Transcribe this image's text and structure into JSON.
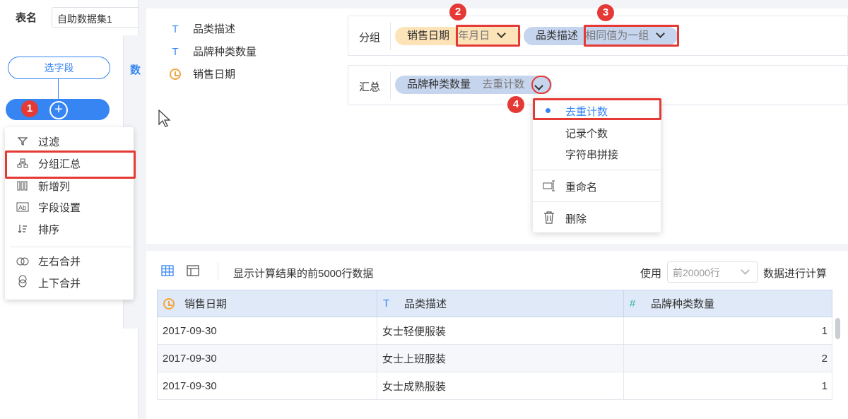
{
  "left_panel": {
    "table_label": "表名",
    "table_name": "自助数据集1",
    "select_fields_label": "选字段",
    "add_label": "+",
    "cut_label": "数"
  },
  "step_menu": {
    "items": [
      {
        "label": "过滤",
        "icon": "filter-icon"
      },
      {
        "label": "分组汇总",
        "icon": "group-icon"
      },
      {
        "label": "新增列",
        "icon": "add-column-icon"
      },
      {
        "label": "字段设置",
        "icon": "field-settings-icon"
      },
      {
        "label": "排序",
        "icon": "sort-icon"
      },
      {
        "label": "左右合并",
        "icon": "merge-horizontal-icon"
      },
      {
        "label": "上下合并",
        "icon": "merge-vertical-icon"
      }
    ]
  },
  "badges": [
    "1",
    "2",
    "3",
    "4"
  ],
  "fields": [
    {
      "label": "品类描述",
      "type": "text",
      "icon": "T"
    },
    {
      "label": "品牌种类数量",
      "type": "text",
      "icon": "T"
    },
    {
      "label": "销售日期",
      "type": "date",
      "icon": "clock-icon"
    }
  ],
  "group": {
    "label": "分组",
    "chips": [
      {
        "field": "销售日期",
        "option": "年月日"
      },
      {
        "field": "品类描述",
        "option": "相同值为一组"
      }
    ]
  },
  "summary": {
    "label": "汇总",
    "chip": {
      "field": "品牌种类数量",
      "option": "去重计数"
    }
  },
  "dropdown": {
    "options": [
      "去重计数",
      "记录个数",
      "字符串拼接"
    ],
    "selected": "去重计数",
    "rename_label": "重命名",
    "delete_label": "删除"
  },
  "table_toolbar": {
    "info": "显示计算结果的前5000行数据",
    "use_label": "使用",
    "rows_select": "前20000行",
    "compute_label": "数据进行计算"
  },
  "table": {
    "headers": [
      {
        "label": "销售日期",
        "icon": "clock-icon"
      },
      {
        "label": "品类描述",
        "icon": "T"
      },
      {
        "label": "品牌种类数量",
        "icon": "#"
      }
    ],
    "rows": [
      [
        "2017-09-30",
        "女士轻便服装",
        "1"
      ],
      [
        "2017-09-30",
        "女士上班服装",
        "2"
      ],
      [
        "2017-09-30",
        "女士成熟服装",
        "1"
      ]
    ]
  },
  "colors": {
    "accent": "#3685f2",
    "highlight": "#e53935",
    "date_chip": "#fde3b8",
    "text_chip": "#c6d5ee"
  }
}
